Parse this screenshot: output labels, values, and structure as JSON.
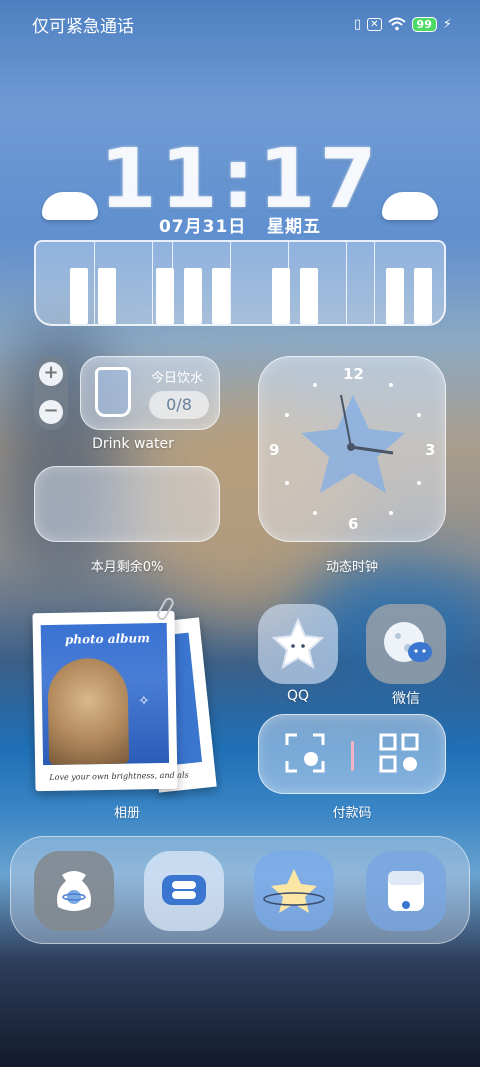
{
  "status_bar": {
    "carrier": "仅可紧急通话",
    "battery": "99",
    "icons": [
      "vibrate-icon",
      "nosim-icon",
      "wifi-icon",
      "battery-icon",
      "charging-icon"
    ]
  },
  "clock_widget": {
    "time": "11:17",
    "date": "07月31日",
    "weekday": "星期五"
  },
  "water_widget": {
    "plus": "+",
    "minus": "−",
    "title": "今日饮水",
    "count": "0/8",
    "caption": "Drink water"
  },
  "month_widget": {
    "caption": "本月剩余0%",
    "progress_percent": 0
  },
  "analog_clock": {
    "n12": "12",
    "n3": "3",
    "n6": "6",
    "n9": "9",
    "caption": "动态时钟"
  },
  "album_widget": {
    "photo_title": "photo album",
    "photo_text": "Love your own brightness, and als",
    "caption": "相册"
  },
  "apps": {
    "qq": "QQ",
    "wechat": "微信",
    "pay": "付款码"
  },
  "colors": {
    "accent_blue": "#3a75d0",
    "clock_hand": "#4a5568",
    "battery_green": "#4cd964"
  }
}
